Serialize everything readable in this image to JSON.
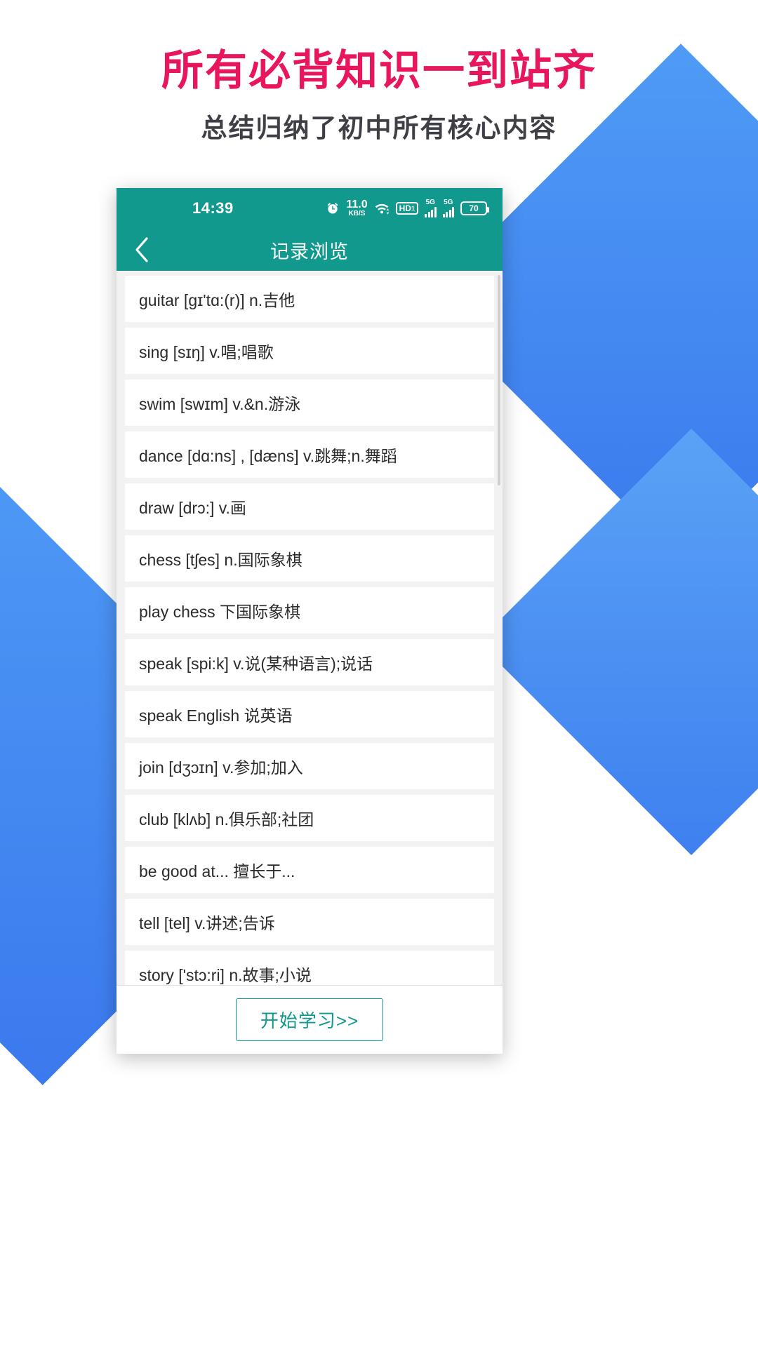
{
  "promo": {
    "headline": "所有必背知识一到站齐",
    "subhead": "总结归纳了初中所有核心内容",
    "headline_color": "#e8175d",
    "accent_color": "#11998e",
    "ribbon_color": "#3d7ef0"
  },
  "statusbar": {
    "time": "14:39",
    "net_speed_value": "11.0",
    "net_speed_unit": "KB/S",
    "hd_label": "HD",
    "hd_sub": "1",
    "sim1_label": "5G",
    "sim2_label": "5G",
    "battery": "70"
  },
  "appbar": {
    "title": "记录浏览",
    "back_label": "返回"
  },
  "list": {
    "items": [
      "guitar  [gɪ'tɑ:(r)] n.吉他",
      "sing  [sɪŋ] v.唱;唱歌",
      "swim  [swɪm] v.&n.游泳",
      "dance  [dɑ:ns] , [dæns] v.跳舞;n.舞蹈",
      "draw  [drɔ:] v.画",
      "chess  [tʃes] n.国际象棋",
      "play chess  下国际象棋",
      "speak  [spi:k] v.说(某种语言);说话",
      "speak English  说英语",
      "join  [dʒɔɪn] v.参加;加入",
      "club  [klʌb] n.俱乐部;社团",
      "be good at...  擅长于...",
      "tell  [tel] v.讲述;告诉",
      "story  ['stɔ:ri] n.故事;小说"
    ]
  },
  "footer": {
    "start_button": "开始学习>>"
  }
}
